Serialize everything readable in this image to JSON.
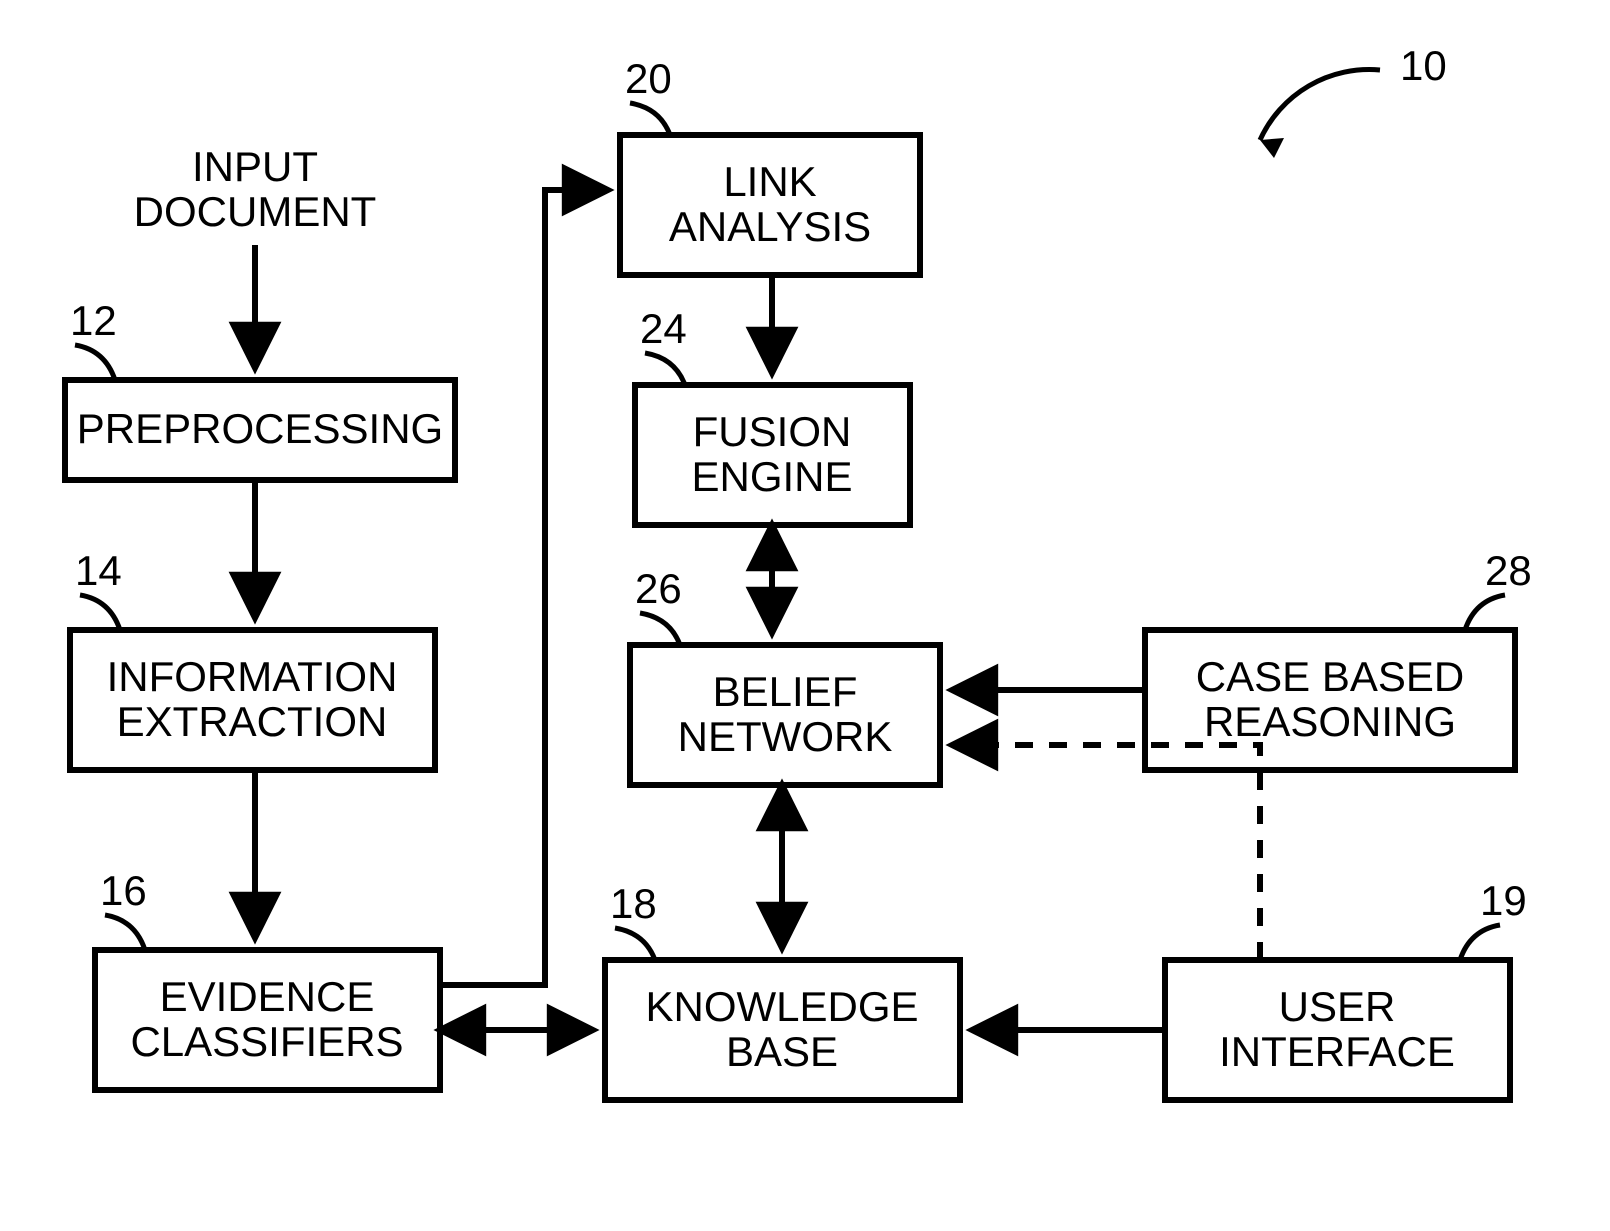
{
  "diagram": {
    "overall_ref": "10",
    "input_label_l1": "INPUT",
    "input_label_l2": "DOCUMENT",
    "nodes": {
      "preprocessing": {
        "ref": "12",
        "l1": "PREPROCESSING"
      },
      "info_extraction": {
        "ref": "14",
        "l1": "INFORMATION",
        "l2": "EXTRACTION"
      },
      "evidence_classifiers": {
        "ref": "16",
        "l1": "EVIDENCE",
        "l2": "CLASSIFIERS"
      },
      "link_analysis": {
        "ref": "20",
        "l1": "LINK",
        "l2": "ANALYSIS"
      },
      "fusion_engine": {
        "ref": "24",
        "l1": "FUSION",
        "l2": "ENGINE"
      },
      "belief_network": {
        "ref": "26",
        "l1": "BELIEF",
        "l2": "NETWORK"
      },
      "knowledge_base": {
        "ref": "18",
        "l1": "KNOWLEDGE",
        "l2": "BASE"
      },
      "user_interface": {
        "ref": "19",
        "l1": "USER",
        "l2": "INTERFACE"
      },
      "case_based_reasoning": {
        "ref": "28",
        "l1": "CASE BASED",
        "l2": "REASONING"
      }
    }
  }
}
